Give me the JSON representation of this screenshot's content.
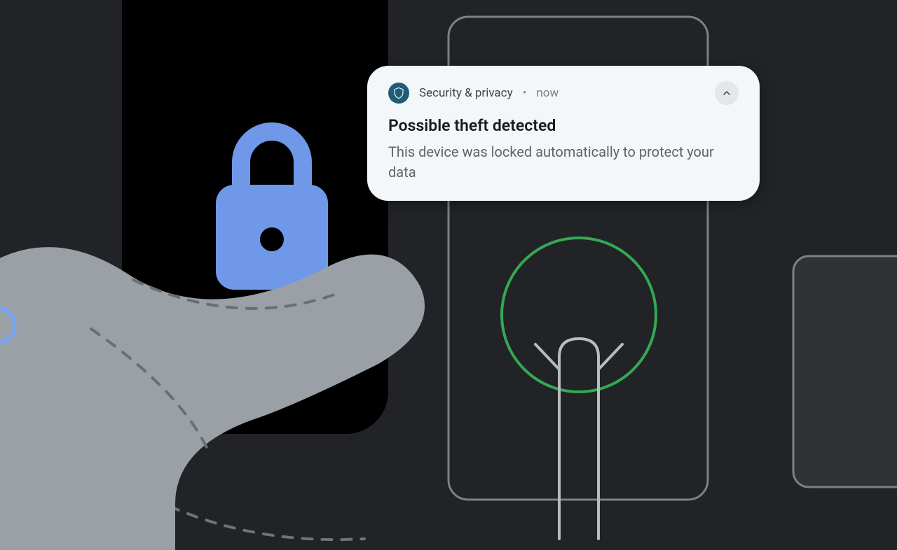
{
  "notification": {
    "app_name": "Security & privacy",
    "separator": "•",
    "timestamp": "now",
    "title": "Possible theft detected",
    "body": "This device was locked automatically to protect your data"
  },
  "icons": {
    "app_icon": "shield-icon",
    "collapse": "chevron-up-icon",
    "phone_lock": "lock-icon",
    "figure": "person-arms-up-icon"
  },
  "colors": {
    "background": "#212326",
    "phone": "#000000",
    "lock": "#6f98e8",
    "hand": "#9aa0a6",
    "notification_bg": "#f3f7f9",
    "app_icon_bg": "#1f5d77",
    "sensor_ring": "#34a853",
    "outline": "#9aa0a6"
  }
}
